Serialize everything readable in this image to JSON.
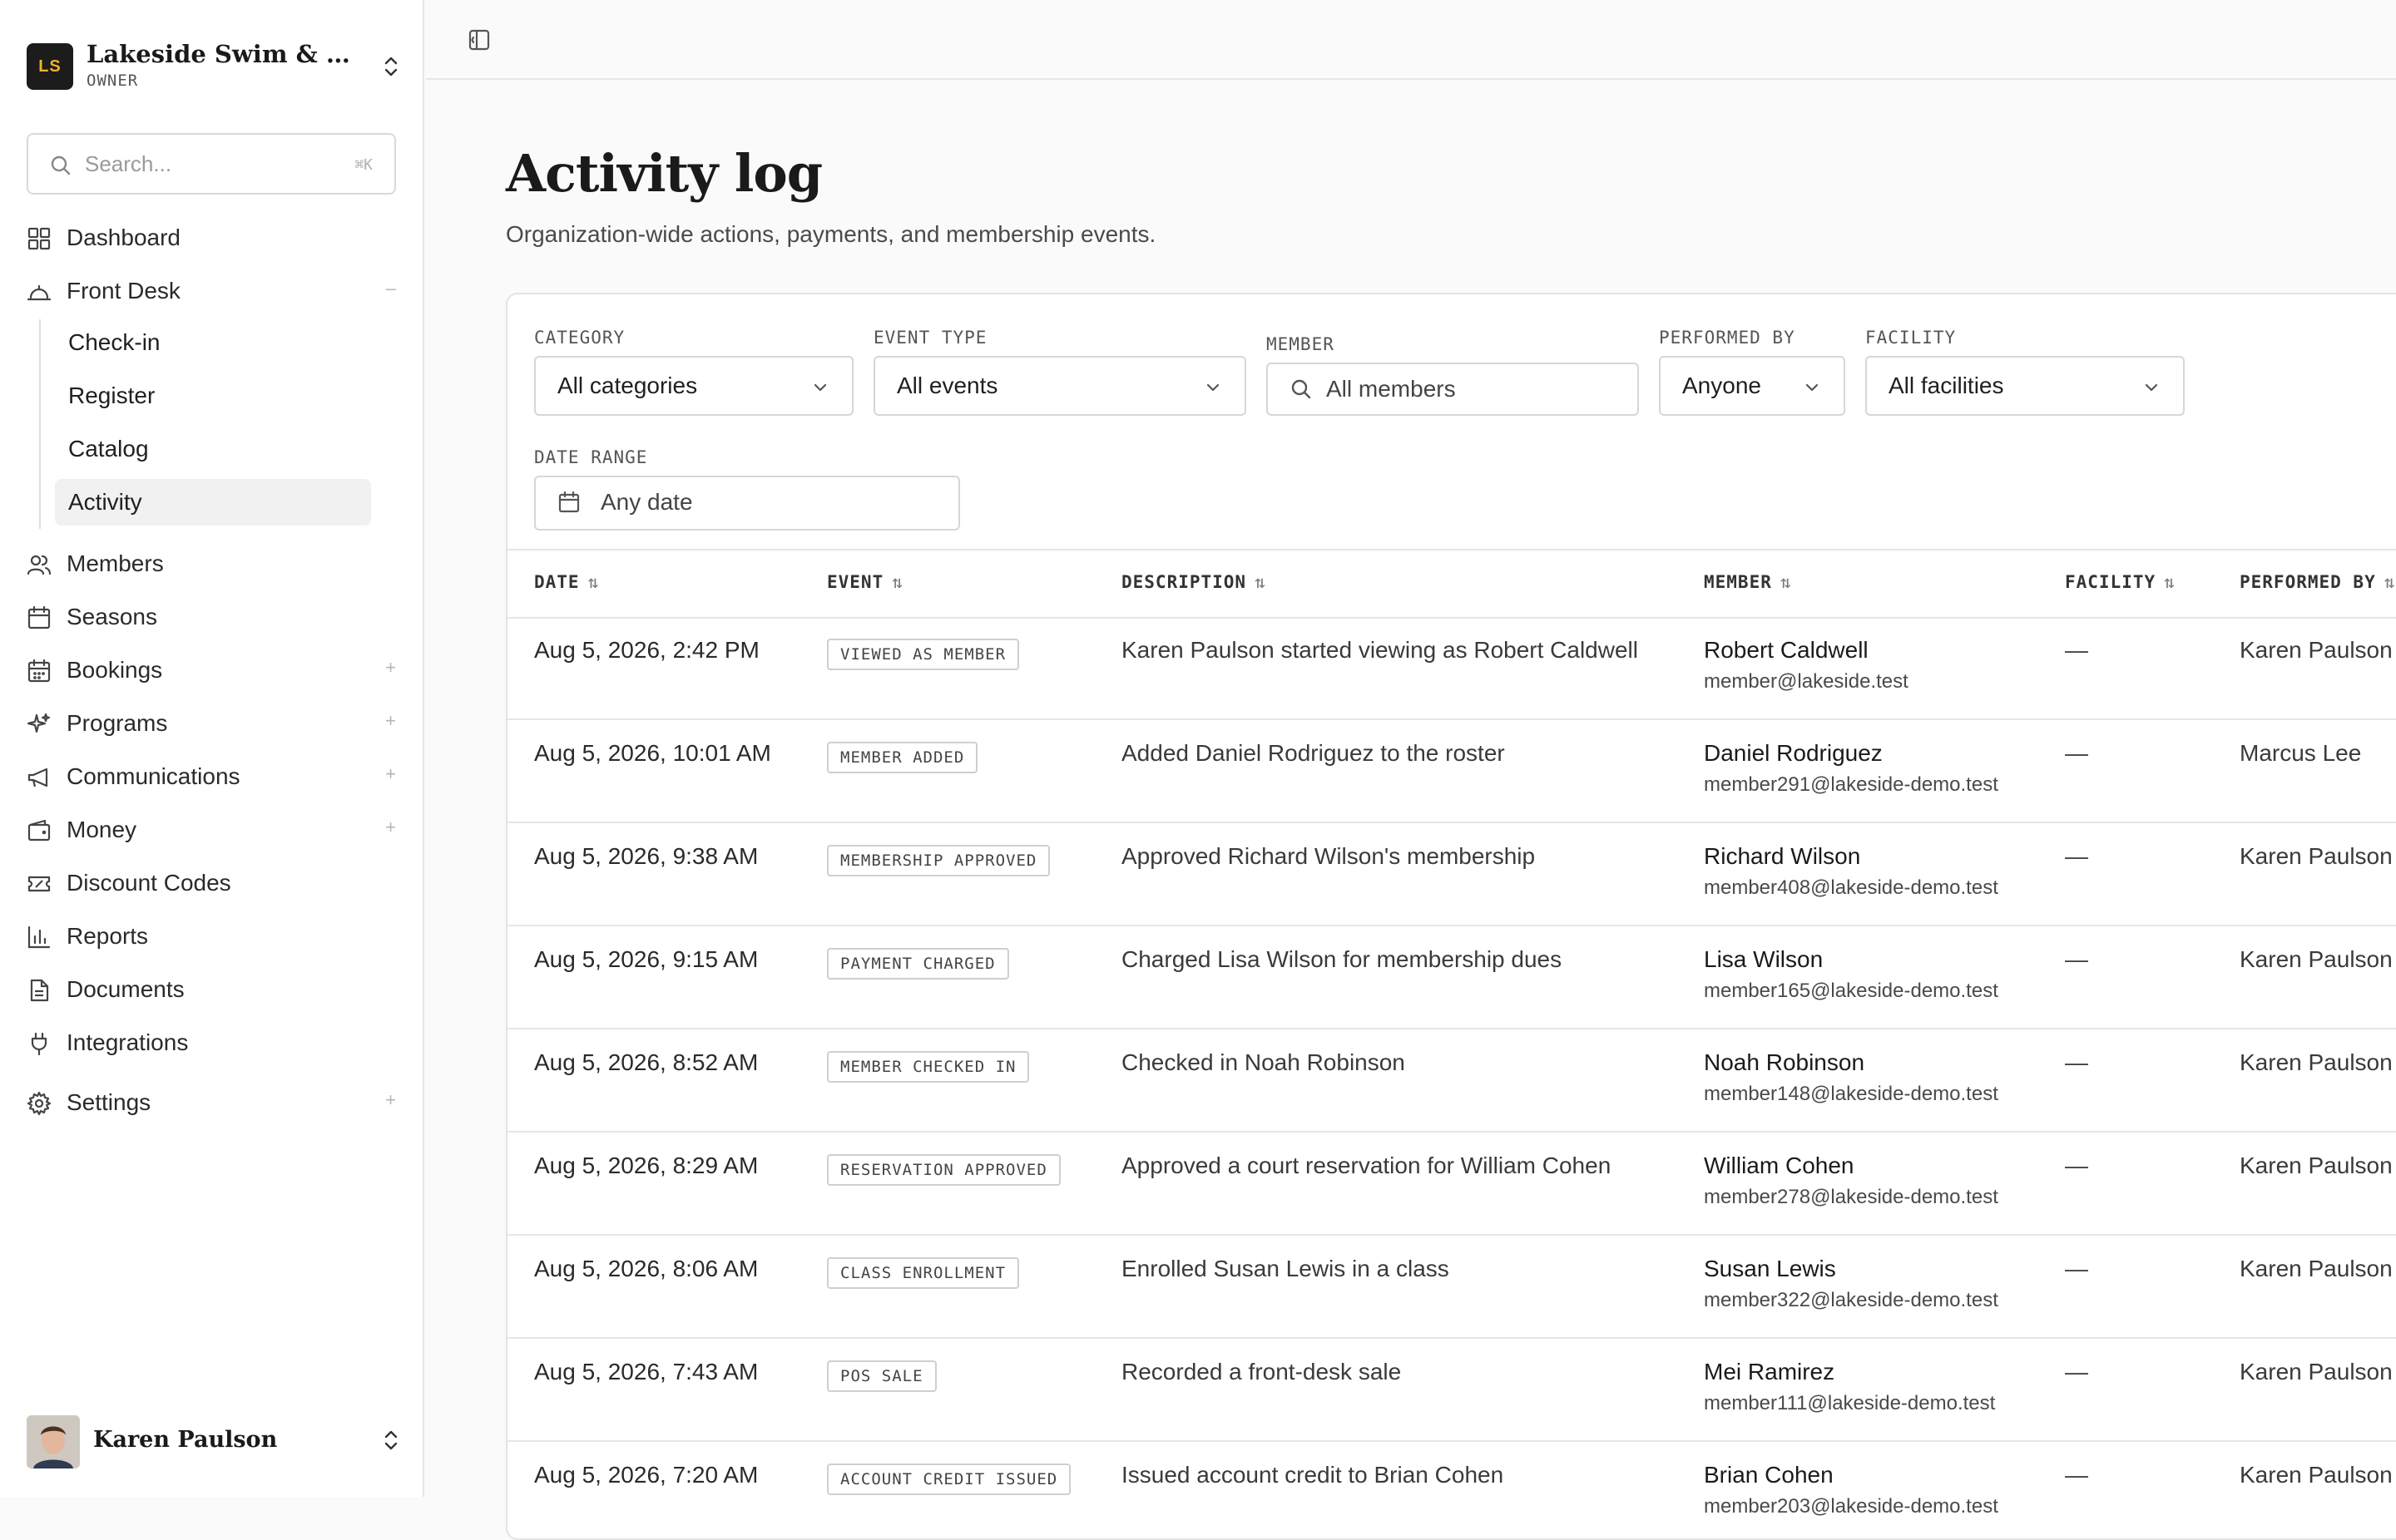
{
  "org": {
    "initials": "LS",
    "name": "Lakeside Swim & Tennis Club",
    "role": "OWNER"
  },
  "search": {
    "placeholder": "Search...",
    "shortcut": "⌘K"
  },
  "nav": {
    "dashboard": "Dashboard",
    "front_desk": "Front Desk",
    "front_desk_toggle": "–",
    "sub": {
      "checkin": "Check-in",
      "register": "Register",
      "catalog": "Catalog",
      "activity": "Activity"
    },
    "members": "Members",
    "seasons": "Seasons",
    "bookings": "Bookings",
    "programs": "Programs",
    "communications": "Communications",
    "money": "Money",
    "discount_codes": "Discount Codes",
    "reports": "Reports",
    "documents": "Documents",
    "integrations": "Integrations",
    "settings": "Settings",
    "expand": "+"
  },
  "user": {
    "name": "Karen Paulson"
  },
  "page": {
    "title": "Activity log",
    "subtitle": "Organization-wide actions, payments, and membership events."
  },
  "filters": {
    "category": {
      "label": "CATEGORY",
      "value": "All categories"
    },
    "event_type": {
      "label": "EVENT TYPE",
      "value": "All events"
    },
    "member": {
      "label": "MEMBER",
      "placeholder": "All members"
    },
    "performed_by": {
      "label": "PERFORMED BY",
      "value": "Anyone"
    },
    "facility": {
      "label": "FACILITY",
      "value": "All facilities"
    },
    "date_range": {
      "label": "DATE RANGE",
      "value": "Any date"
    }
  },
  "table": {
    "columns": {
      "date": "DATE",
      "event": "EVENT",
      "description": "DESCRIPTION",
      "member": "MEMBER",
      "facility": "FACILITY",
      "performed_by": "PERFORMED BY"
    },
    "sort_glyph": "⇅",
    "rows": [
      {
        "date": "Aug 5, 2026, 2:42 PM",
        "event": "VIEWED AS MEMBER",
        "description": "Karen Paulson started viewing as Robert Caldwell",
        "member_name": "Robert Caldwell",
        "member_email": "member@lakeside.test",
        "facility": "—",
        "performed_by": "Karen Paulson"
      },
      {
        "date": "Aug 5, 2026, 10:01 AM",
        "event": "MEMBER ADDED",
        "description": "Added Daniel Rodriguez to the roster",
        "member_name": "Daniel Rodriguez",
        "member_email": "member291@lakeside-demo.test",
        "facility": "—",
        "performed_by": "Marcus Lee"
      },
      {
        "date": "Aug 5, 2026, 9:38 AM",
        "event": "MEMBERSHIP APPROVED",
        "description": "Approved Richard Wilson's membership",
        "member_name": "Richard Wilson",
        "member_email": "member408@lakeside-demo.test",
        "facility": "—",
        "performed_by": "Karen Paulson"
      },
      {
        "date": "Aug 5, 2026, 9:15 AM",
        "event": "PAYMENT CHARGED",
        "description": "Charged Lisa Wilson for membership dues",
        "member_name": "Lisa Wilson",
        "member_email": "member165@lakeside-demo.test",
        "facility": "—",
        "performed_by": "Karen Paulson"
      },
      {
        "date": "Aug 5, 2026, 8:52 AM",
        "event": "MEMBER CHECKED IN",
        "description": "Checked in Noah Robinson",
        "member_name": "Noah Robinson",
        "member_email": "member148@lakeside-demo.test",
        "facility": "—",
        "performed_by": "Karen Paulson"
      },
      {
        "date": "Aug 5, 2026, 8:29 AM",
        "event": "RESERVATION APPROVED",
        "description": "Approved a court reservation for William Cohen",
        "member_name": "William Cohen",
        "member_email": "member278@lakeside-demo.test",
        "facility": "—",
        "performed_by": "Karen Paulson"
      },
      {
        "date": "Aug 5, 2026, 8:06 AM",
        "event": "CLASS ENROLLMENT",
        "description": "Enrolled Susan Lewis in a class",
        "member_name": "Susan Lewis",
        "member_email": "member322@lakeside-demo.test",
        "facility": "—",
        "performed_by": "Karen Paulson"
      },
      {
        "date": "Aug 5, 2026, 7:43 AM",
        "event": "POS SALE",
        "description": "Recorded a front-desk sale",
        "member_name": "Mei Ramirez",
        "member_email": "member111@lakeside-demo.test",
        "facility": "—",
        "performed_by": "Karen Paulson"
      },
      {
        "date": "Aug 5, 2026, 7:20 AM",
        "event": "ACCOUNT CREDIT ISSUED",
        "description": "Issued account credit to Brian Cohen",
        "member_name": "Brian Cohen",
        "member_email": "member203@lakeside-demo.test",
        "facility": "—",
        "performed_by": "Karen Paulson"
      }
    ]
  }
}
